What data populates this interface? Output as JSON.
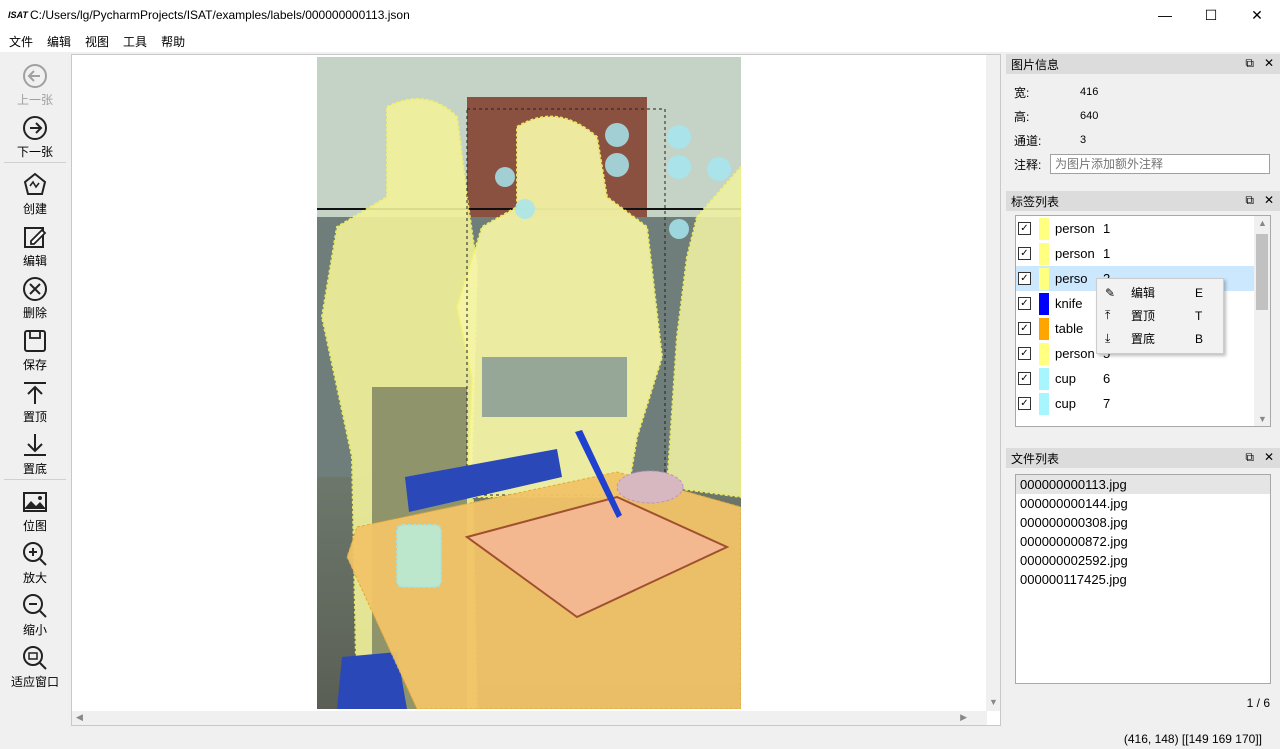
{
  "window": {
    "app_icon_text": "ISAT",
    "title": "C:/Users/lg/PycharmProjects/ISAT/examples/labels/000000000113.json"
  },
  "menu": [
    "文件",
    "编辑",
    "视图",
    "工具",
    "帮助"
  ],
  "toolbar": {
    "prev": "上一张",
    "next": "下一张",
    "create": "创建",
    "edit": "编辑",
    "delete": "删除",
    "save": "保存",
    "to_top": "置顶",
    "to_bottom": "置底",
    "bitmap": "位图",
    "zoom_in": "放大",
    "zoom_out": "缩小",
    "fit_window": "适应窗口"
  },
  "image_info": {
    "title": "图片信息",
    "width_label": "宽:",
    "width": "416",
    "height_label": "高:",
    "height": "640",
    "channels_label": "通道:",
    "channels": "3",
    "note_label": "注释:",
    "note_placeholder": "为图片添加额外注释"
  },
  "label_list": {
    "title": "标签列表",
    "items": [
      {
        "name": "person",
        "group": "1",
        "color": "#ffff80",
        "checked": true
      },
      {
        "name": "person",
        "group": "1",
        "color": "#ffff80",
        "checked": true
      },
      {
        "name": "perso",
        "group": "2",
        "color": "#ffff80",
        "checked": true
      },
      {
        "name": "knife",
        "group": "",
        "color": "#0000ff",
        "checked": true
      },
      {
        "name": "table",
        "group": "",
        "color": "#ffa500",
        "checked": true
      },
      {
        "name": "person",
        "group": "5",
        "color": "#ffff80",
        "checked": true
      },
      {
        "name": "cup",
        "group": "6",
        "color": "#a6f5ff",
        "checked": true
      },
      {
        "name": "cup",
        "group": "7",
        "color": "#a6f5ff",
        "checked": true
      }
    ]
  },
  "context_menu": {
    "items": [
      {
        "icon": "edit-icon",
        "label": "编辑",
        "key": "E"
      },
      {
        "icon": "to-top-icon",
        "label": "置顶",
        "key": "T"
      },
      {
        "icon": "to-bottom-icon",
        "label": "置底",
        "key": "B"
      }
    ]
  },
  "file_list": {
    "title": "文件列表",
    "files": [
      "000000000113.jpg",
      "000000000144.jpg",
      "000000000308.jpg",
      "000000000872.jpg",
      "000000002592.jpg",
      "000000117425.jpg"
    ],
    "page": "1 / 6"
  },
  "status": {
    "cursor": "(416, 148) [[149 169 170]]"
  }
}
